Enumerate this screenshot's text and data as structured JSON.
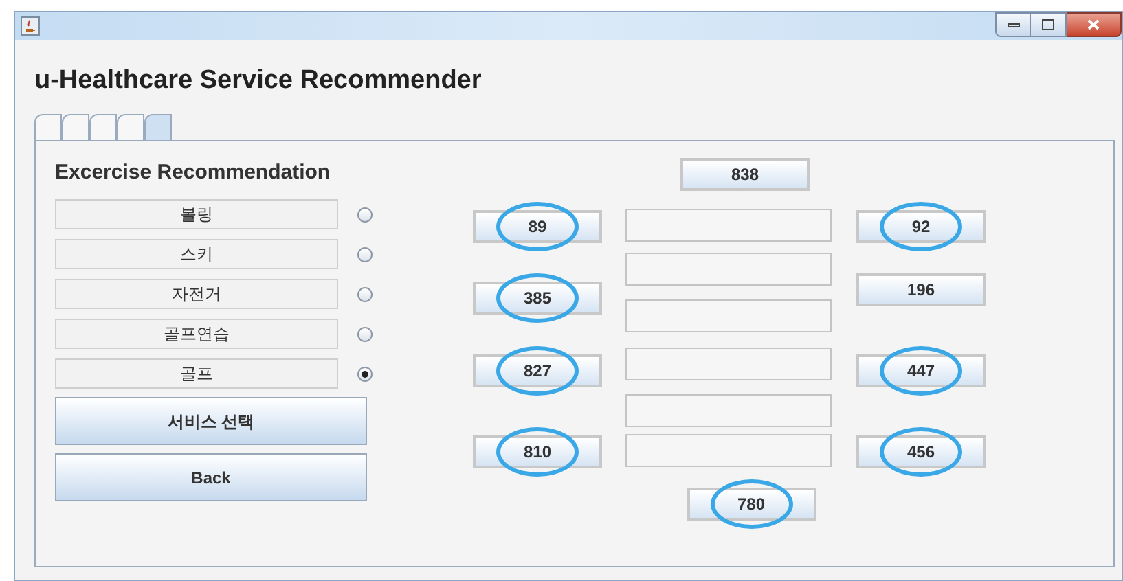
{
  "window": {
    "title": "u-Healthcare Service Recommender"
  },
  "tabs": [
    {
      "selected": false
    },
    {
      "selected": false
    },
    {
      "selected": false
    },
    {
      "selected": false
    },
    {
      "selected": true
    }
  ],
  "panel": {
    "heading": "Excercise Recommendation",
    "options": [
      {
        "label": "볼링",
        "selected": false
      },
      {
        "label": "스키",
        "selected": false
      },
      {
        "label": "자전거",
        "selected": false
      },
      {
        "label": "골프연습",
        "selected": false
      },
      {
        "label": "골프",
        "selected": true
      }
    ],
    "buttons": [
      "서비스 선택",
      "Back"
    ]
  },
  "top_button": {
    "label": "838",
    "circled": false
  },
  "left_buttons": [
    {
      "label": "89",
      "circled": true
    },
    {
      "label": "385",
      "circled": true
    },
    {
      "label": "827",
      "circled": true
    },
    {
      "label": "810",
      "circled": true
    }
  ],
  "right_buttons": [
    {
      "label": "92",
      "circled": true
    },
    {
      "label": "196",
      "circled": false
    },
    {
      "label": "447",
      "circled": true
    },
    {
      "label": "456",
      "circled": true
    }
  ],
  "bottom_button": {
    "label": "780",
    "circled": true
  }
}
